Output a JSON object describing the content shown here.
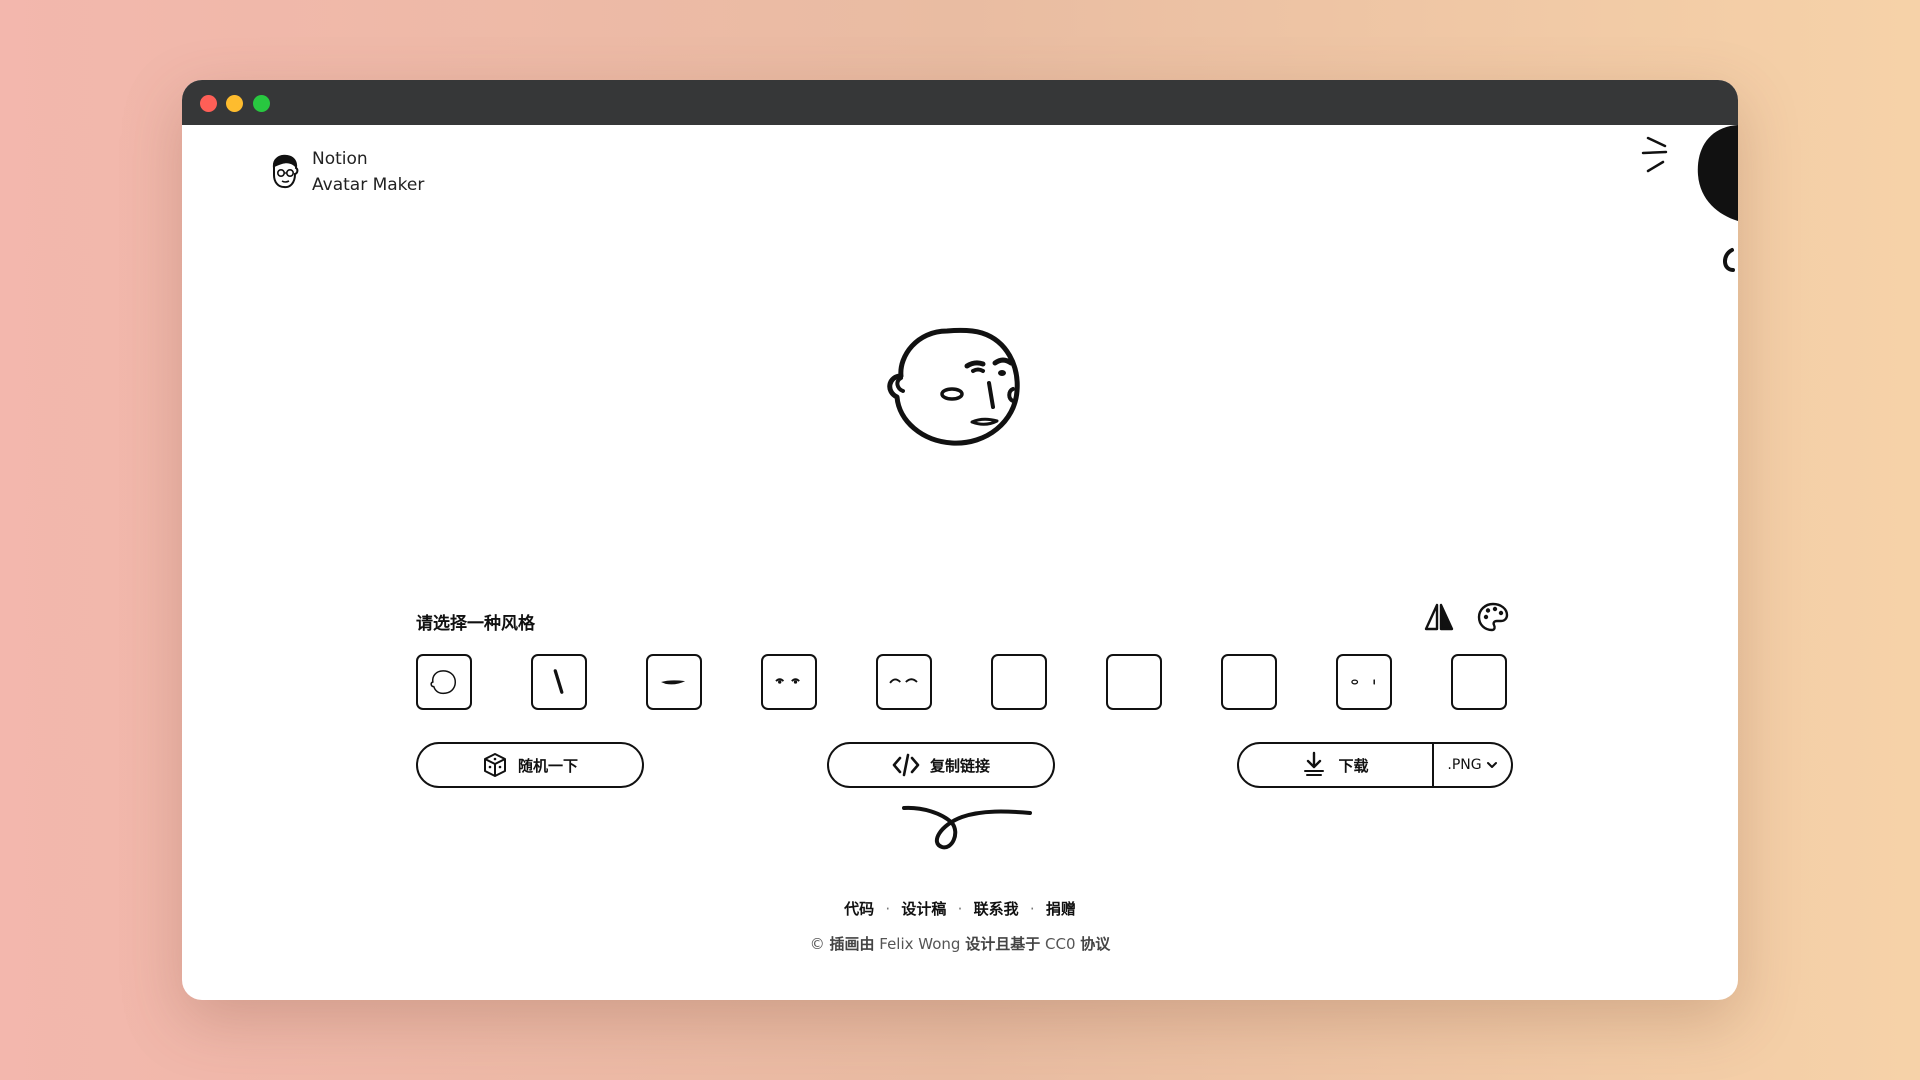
{
  "window": {
    "traffic_lights": {
      "close": "#fe5f57",
      "minimize": "#febc2e",
      "maximize": "#28c840"
    }
  },
  "brand": {
    "line1": "Notion",
    "line2": "Avatar Maker"
  },
  "selector": {
    "label": "请选择一种风格"
  },
  "tools": {
    "flip_icon": "flip-horizontal-icon",
    "palette_icon": "palette-icon"
  },
  "style_items": [
    {
      "name": "face"
    },
    {
      "name": "nose"
    },
    {
      "name": "mouth"
    },
    {
      "name": "eyes"
    },
    {
      "name": "eyebrows"
    },
    {
      "name": "glasses"
    },
    {
      "name": "hair"
    },
    {
      "name": "accessories"
    },
    {
      "name": "details"
    },
    {
      "name": "beard"
    }
  ],
  "actions": {
    "random_label": "随机一下",
    "copy_link_label": "复制链接",
    "download_label": "下载",
    "format_value": ".PNG"
  },
  "footer": {
    "links": [
      "代码",
      "设计稿",
      "联系我",
      "捐赠"
    ],
    "separator": "·",
    "credit_prefix": "© ",
    "credit_bold1": "插画由",
    "credit_name": " Felix Wong ",
    "credit_bold2": "设计且基于",
    "credit_license": " CC0 ",
    "credit_bold3": "协议"
  }
}
